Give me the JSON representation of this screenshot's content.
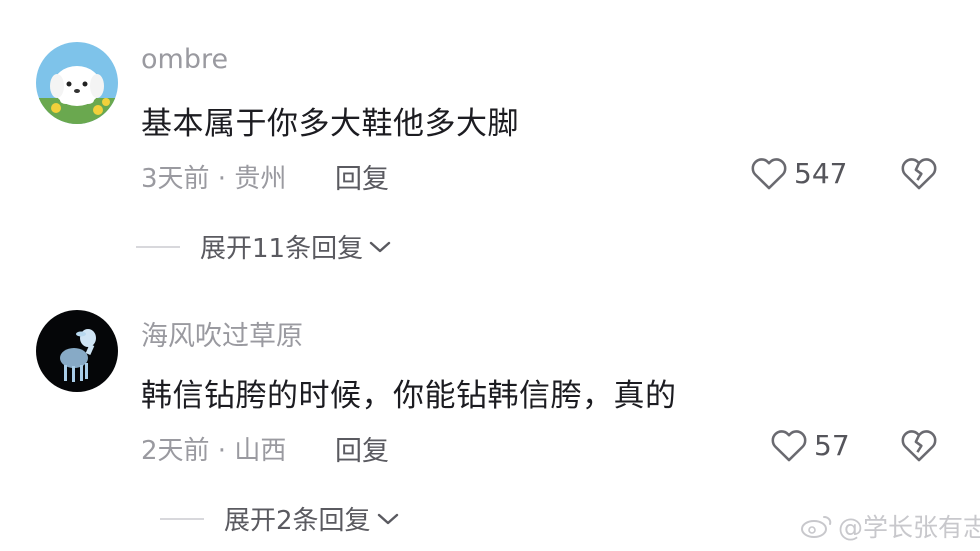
{
  "comments": [
    {
      "username": "ombre",
      "text": "基本属于你多大鞋他多大脚",
      "meta": "3天前 · 贵州",
      "reply_label": "回复",
      "like_count": "547",
      "expand_label": "展开11条回复"
    },
    {
      "username": "海风吹过草原",
      "text": "韩信钻胯的时候，你能钻韩信胯，真的",
      "meta": "2天前 · 山西",
      "reply_label": "回复",
      "like_count": "57",
      "expand_label": "展开2条回复"
    }
  ],
  "watermark": "@学长张有志",
  "colors": {
    "muted": "#9a9aa0",
    "text": "#1c1c21",
    "icon": "#6a6a70"
  },
  "icons": {
    "like": "heart-outline-icon",
    "dislike": "broken-heart-icon",
    "expand": "chevron-down-icon"
  }
}
